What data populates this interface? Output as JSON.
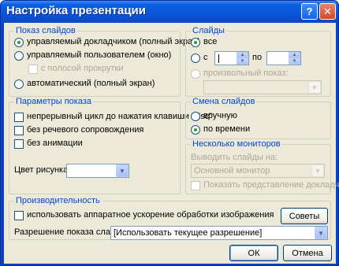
{
  "window": {
    "title": "Настройка презентации",
    "help_glyph": "?",
    "close_glyph": "✕"
  },
  "show_type": {
    "title": "Показ слайдов",
    "options": [
      {
        "label": "управляемый докладчиком (полный экран)",
        "selected": true
      },
      {
        "label": "управляемый пользователем (окно)",
        "selected": false
      },
      {
        "label": "автоматический (полный экран)",
        "selected": false
      }
    ],
    "scrollbar_checkbox": {
      "label": "с полосой прокрутки",
      "checked": false,
      "enabled": false
    }
  },
  "show_options": {
    "title": "Параметры показа",
    "checkboxes": [
      {
        "label": "непрерывный цикл до нажатия клавиши \"Esc\"",
        "checked": false
      },
      {
        "label": "без речевого сопровождения",
        "checked": false
      },
      {
        "label": "без анимации",
        "checked": false
      }
    ],
    "pen_color_label": "Цвет рисунка:",
    "pen_color_value": ""
  },
  "slides": {
    "title": "Слайды",
    "all_label": "все",
    "from_label": "с",
    "to_label": "по",
    "from_value": "",
    "to_value": "",
    "custom_label": "произвольный показ:",
    "custom_value": "",
    "selected": "all"
  },
  "advance": {
    "title": "Смена слайдов",
    "options": [
      {
        "label": "вручную",
        "selected": false
      },
      {
        "label": "по времени",
        "selected": true
      }
    ]
  },
  "monitors": {
    "title": "Несколько мониторов",
    "display_label": "Выводить слайды на:",
    "display_value": "Основной монитор",
    "presenter_view_label": "Показать представление докладчика"
  },
  "performance": {
    "title": "Производительность",
    "hw_accel_label": "использовать аппаратное ускорение обработки изображения",
    "hw_accel_checked": false,
    "tips_button": "Советы",
    "resolution_label": "Разрешение показа слайдов:",
    "resolution_value": "[Использовать текущее разрешение]"
  },
  "buttons": {
    "ok": "ОК",
    "cancel": "Отмена"
  },
  "icons": {
    "dropdown": "chevron-down-icon",
    "spin_up": "arrow-up-icon",
    "spin_down": "arrow-down-icon"
  }
}
